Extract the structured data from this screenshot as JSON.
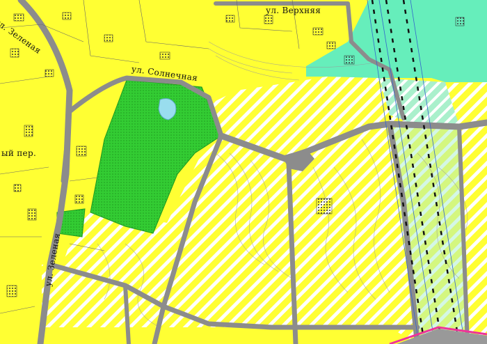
{
  "map": {
    "street_labels": {
      "verkhnyaya": "ул. Верхняя",
      "solnechnaya": "ул. Солнечная",
      "zelenaya_top": "ул. Зеленая",
      "zelenaya_bottom": "ул. Зеленая",
      "pereulok": "ый пер."
    },
    "colors": {
      "residential_zone": "#ffff33",
      "planned_zone_hatch": "#ffffff",
      "green_zone": "#33cc33",
      "forest_zone": "#66eebb",
      "road": "#8c8c8c",
      "water": "#99ddee",
      "boundary": "#ee3399"
    }
  }
}
